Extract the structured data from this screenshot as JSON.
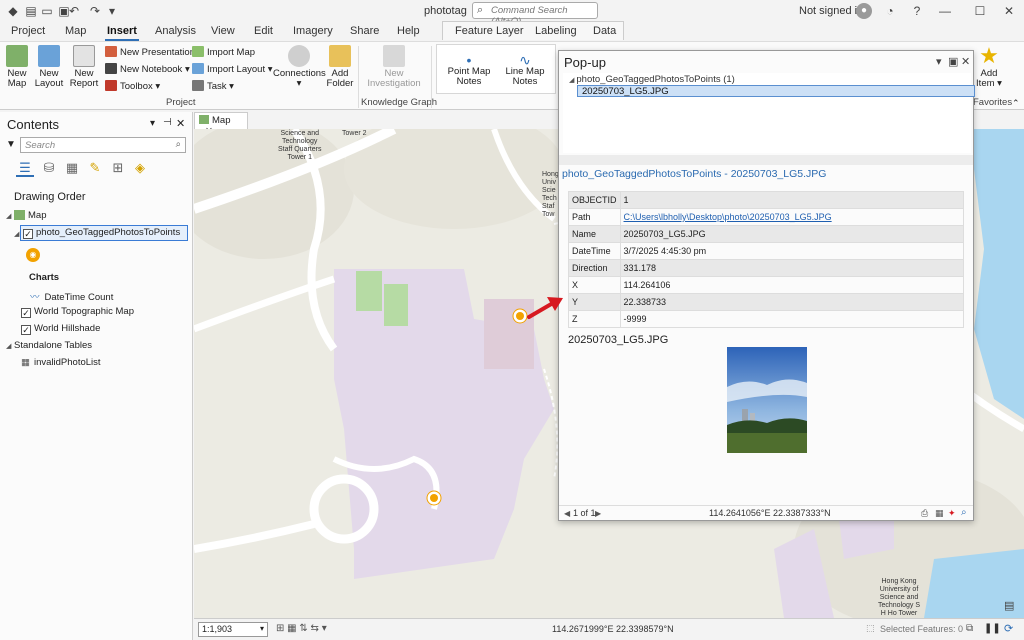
{
  "window": {
    "title": "phototag",
    "command_search_placeholder": "Command Search (Alt+Q)",
    "signin": "Not signed in"
  },
  "tabs": [
    "Project",
    "Map",
    "Insert",
    "Analysis",
    "View",
    "Edit",
    "Imagery",
    "Share",
    "Help"
  ],
  "active_tab": "Insert",
  "context_tabs": [
    "Feature Layer",
    "Labeling",
    "Data"
  ],
  "ribbon": {
    "new_map": "New\nMap",
    "new_layout": "New\nLayout",
    "new_report": "New\nReport",
    "new_presentation": "New Presentation",
    "new_notebook": "New Notebook",
    "toolbox": "Toolbox",
    "import_map": "Import Map",
    "import_layout": "Import Layout",
    "task": "Task",
    "connections": "Connections",
    "add_folder": "Add\nFolder",
    "project_group": "Project",
    "new_investigation": "New\nInvestigation",
    "knowledge_graph_group": "Knowledge Graph",
    "point_map_notes": "Point Map\nNotes",
    "line_map_notes": "Line Map\nNotes",
    "add_item": "Add\nItem",
    "favorites_group": "Favorites"
  },
  "contents": {
    "title": "Contents",
    "search_placeholder": "Search",
    "drawing_order": "Drawing Order",
    "map": "Map",
    "layer": "photo_GeoTaggedPhotosToPoints",
    "charts": "Charts",
    "chart_item": "DateTime Count",
    "basemap1": "World Topographic Map",
    "basemap2": "World Hillshade",
    "standalone_tables": "Standalone Tables",
    "table1": "invalidPhotoList"
  },
  "map": {
    "tab_label": "Map",
    "labels": {
      "sq": "Science and\nTechnology\nStaff Quarters\nTower 1",
      "tower2": "Tower 2",
      "univ": "Hong\nUniv\nScie\nTech\nStaf\nTow",
      "hkust": "Hong Kong\nUniversity of\nScience and\nTechnology S\nH Ho Tower"
    }
  },
  "status": {
    "scale": "1:1,903",
    "coords": "114.2671999°E 22.3398579°N",
    "selected_features": "Selected Features: 0"
  },
  "popup": {
    "title": "Pop-up",
    "layer_node": "photo_GeoTaggedPhotosToPoints  (1)",
    "feature_node": "20250703_LG5.JPG",
    "header": "photo_GeoTaggedPhotosToPoints - 20250703_LG5.JPG",
    "attributes": [
      {
        "key": "OBJECTID",
        "value": "1"
      },
      {
        "key": "Path",
        "value": "C:\\Users\\lbholly\\Desktop\\photo\\20250703_LG5.JPG",
        "link": true
      },
      {
        "key": "Name",
        "value": "20250703_LG5.JPG"
      },
      {
        "key": "DateTime",
        "value": "3/7/2025 4:45:30 pm"
      },
      {
        "key": "Direction",
        "value": "331.178"
      },
      {
        "key": "X",
        "value": "114.264106"
      },
      {
        "key": "Y",
        "value": "22.338733"
      },
      {
        "key": "Z",
        "value": "-9999"
      }
    ],
    "image_title": "20250703_LG5.JPG",
    "pager": "1 of 1",
    "footer_coords": "114.2641056°E 22.3387333°N"
  },
  "colors": {
    "accent": "#2f6fb5",
    "campus": "#e3d9ea",
    "green": "#b6dba4",
    "water": "#a9d6f0",
    "marker": "#f2a200",
    "arrow": "#d71920"
  }
}
